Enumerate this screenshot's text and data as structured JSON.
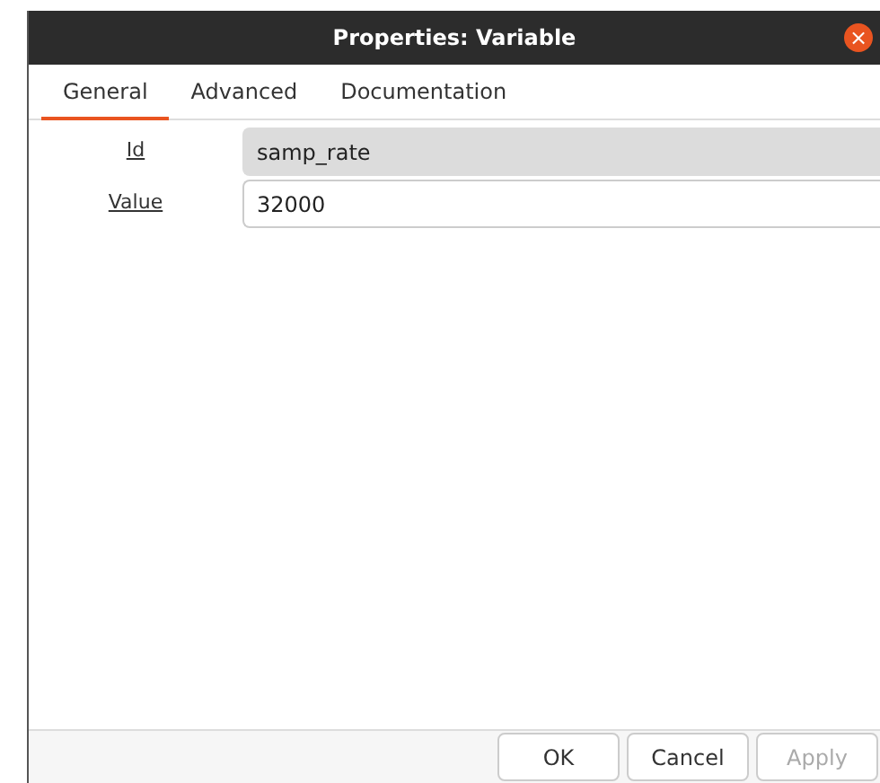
{
  "window": {
    "title": "Properties: Variable",
    "close": "×"
  },
  "tabs": [
    {
      "label": "General",
      "selected": true
    },
    {
      "label": "Advanced",
      "selected": false
    },
    {
      "label": "Documentation",
      "selected": false
    }
  ],
  "fields": [
    {
      "label": "Id",
      "value": "samp_rate",
      "disabled": true
    },
    {
      "label": "Value",
      "value": "32000",
      "disabled": false
    }
  ],
  "buttons": [
    {
      "label": "OK",
      "disabled": false
    },
    {
      "label": "Cancel",
      "disabled": false
    },
    {
      "label": "Apply",
      "disabled": true
    }
  ]
}
